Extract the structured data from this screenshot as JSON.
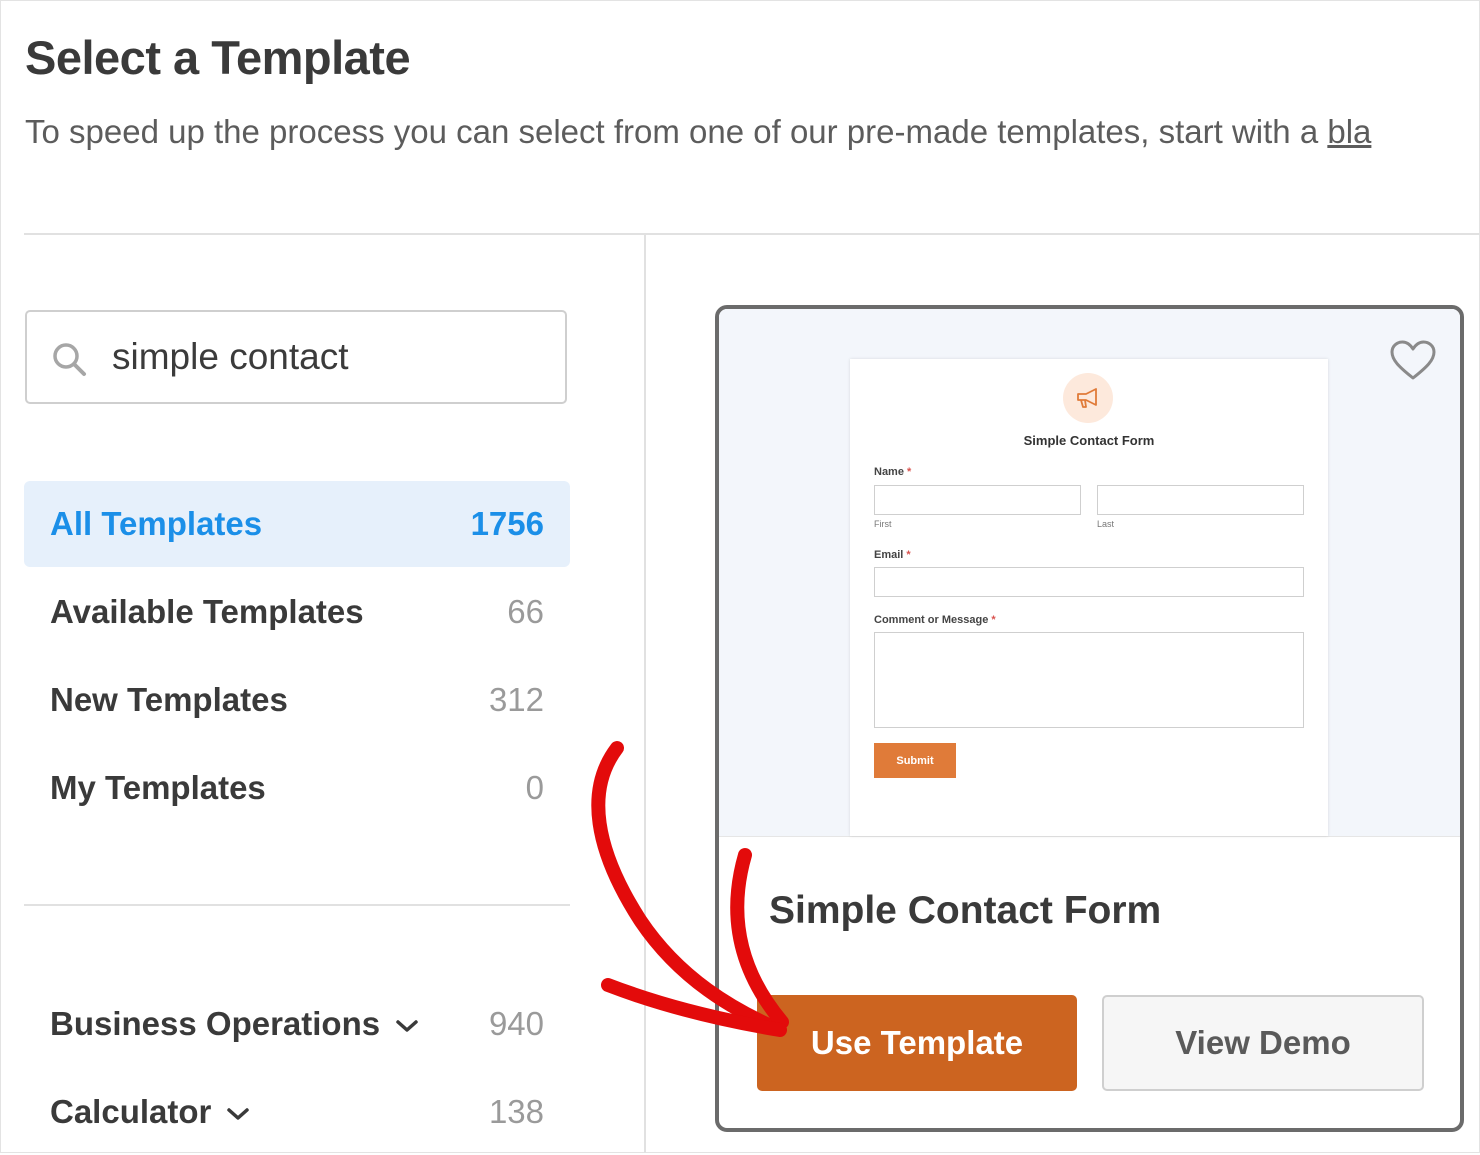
{
  "header": {
    "title": "Select a Template",
    "subtitle_text": "To speed up the process you can select from one of our pre-made templates, start with a ",
    "subtitle_link": "bla"
  },
  "search": {
    "value": "simple contact",
    "icon": "search-icon"
  },
  "sidebar": {
    "filters": [
      {
        "label": "All Templates",
        "count": "1756",
        "active": true
      },
      {
        "label": "Available Templates",
        "count": "66"
      },
      {
        "label": "New Templates",
        "count": "312"
      },
      {
        "label": "My Templates",
        "count": "0"
      }
    ],
    "categories": [
      {
        "label": "Business Operations",
        "count": "940",
        "icon": "chevron-down-icon"
      },
      {
        "label": "Calculator",
        "count": "138",
        "icon": "chevron-down-icon"
      }
    ]
  },
  "template_card": {
    "name": "Simple Contact Form",
    "favorite_icon": "heart-icon",
    "use_label": "Use Template",
    "demo_label": "View Demo",
    "preview": {
      "logo_icon": "megaphone-icon",
      "title": "Simple Contact Form",
      "name_label": "Name",
      "first_label": "First",
      "last_label": "Last",
      "email_label": "Email",
      "message_label": "Comment or Message",
      "required_mark": "*",
      "submit_label": "Submit"
    }
  },
  "colors": {
    "accent_blue": "#1b8fe8",
    "active_bg": "#e6f0fb",
    "use_button": "#cc6420",
    "submit_button": "#e07b39",
    "annotation_arrow": "#e30b0b"
  }
}
